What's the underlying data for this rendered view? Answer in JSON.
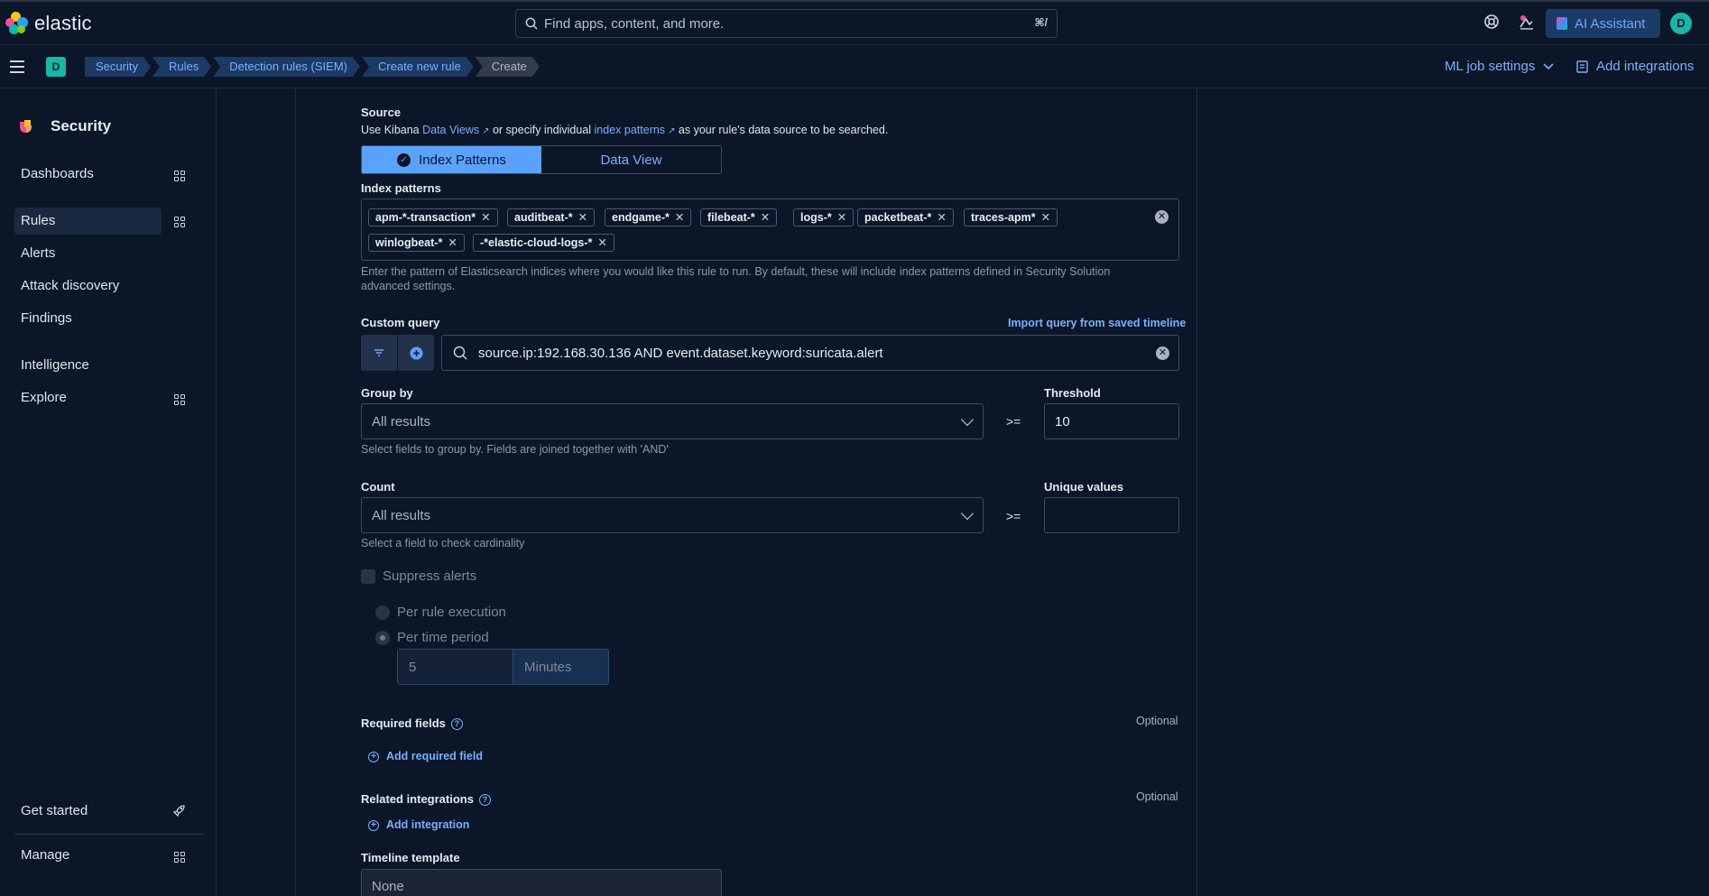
{
  "app": {
    "logo_text": "elastic",
    "search_placeholder": "Find apps, content, and more.",
    "search_shortcut": "⌘/",
    "ai_assistant_label": "AI Assistant",
    "user_initial": "D",
    "space_initial": "D"
  },
  "breadcrumbs": [
    "Security",
    "Rules",
    "Detection rules (SIEM)",
    "Create new rule",
    "Create"
  ],
  "subbar": {
    "ml_job_settings": "ML job settings",
    "add_integrations": "Add integrations"
  },
  "sidebar": {
    "title": "Security",
    "items": [
      {
        "label": "Dashboards"
      },
      {
        "label": "Rules"
      },
      {
        "label": "Alerts"
      },
      {
        "label": "Attack discovery"
      },
      {
        "label": "Findings"
      },
      {
        "label": "Intelligence"
      },
      {
        "label": "Explore"
      }
    ],
    "get_started": "Get started",
    "manage": "Manage"
  },
  "form": {
    "source": {
      "label": "Source",
      "help_prefix": "Use Kibana ",
      "data_views_link": "Data Views",
      "help_middle": " or specify individual ",
      "index_patterns_link": "index patterns",
      "help_suffix": " as your rule's data source to be searched.",
      "tab_index_patterns": "Index Patterns",
      "tab_data_view": "Data View"
    },
    "index_patterns": {
      "label": "Index patterns",
      "pills": [
        "apm-*-transaction*",
        "auditbeat-*",
        "endgame-*",
        "filebeat-*",
        "logs-*",
        "packetbeat-*",
        "traces-apm*",
        "winlogbeat-*",
        "-*elastic-cloud-logs-*"
      ],
      "help_line1": "Enter the pattern of Elasticsearch indices where you would like this rule to run. By default, these will include index patterns defined in Security Solution",
      "help_line2": "advanced settings."
    },
    "custom_query": {
      "label": "Custom query",
      "import_link": "Import query from saved timeline",
      "value": "source.ip:192.168.30.136 AND event.dataset.keyword:suricata.alert"
    },
    "group_by": {
      "label": "Group by",
      "value": "All results",
      "help": "Select fields to group by. Fields are joined together with 'AND'",
      "operator": ">="
    },
    "threshold": {
      "label": "Threshold",
      "value": "10"
    },
    "count": {
      "label": "Count",
      "value": "All results",
      "help": "Select a field to check cardinality",
      "operator": ">="
    },
    "unique_values": {
      "label": "Unique values",
      "value": ""
    },
    "suppress": {
      "label": "Suppress alerts",
      "option_per_rule": "Per rule execution",
      "option_per_time": "Per time period",
      "period_value": "5",
      "period_unit": "Minutes"
    },
    "required_fields": {
      "label": "Required fields",
      "optional": "Optional",
      "add_link": "Add required field"
    },
    "related_integrations": {
      "label": "Related integrations",
      "optional": "Optional",
      "add_link": "Add integration"
    },
    "timeline_template": {
      "label": "Timeline template",
      "value": "None"
    }
  },
  "colors": {
    "background": "#0b1628",
    "accent": "#5aa2ff",
    "link": "#78b0ff",
    "brand_teal": "#14b8a6"
  }
}
